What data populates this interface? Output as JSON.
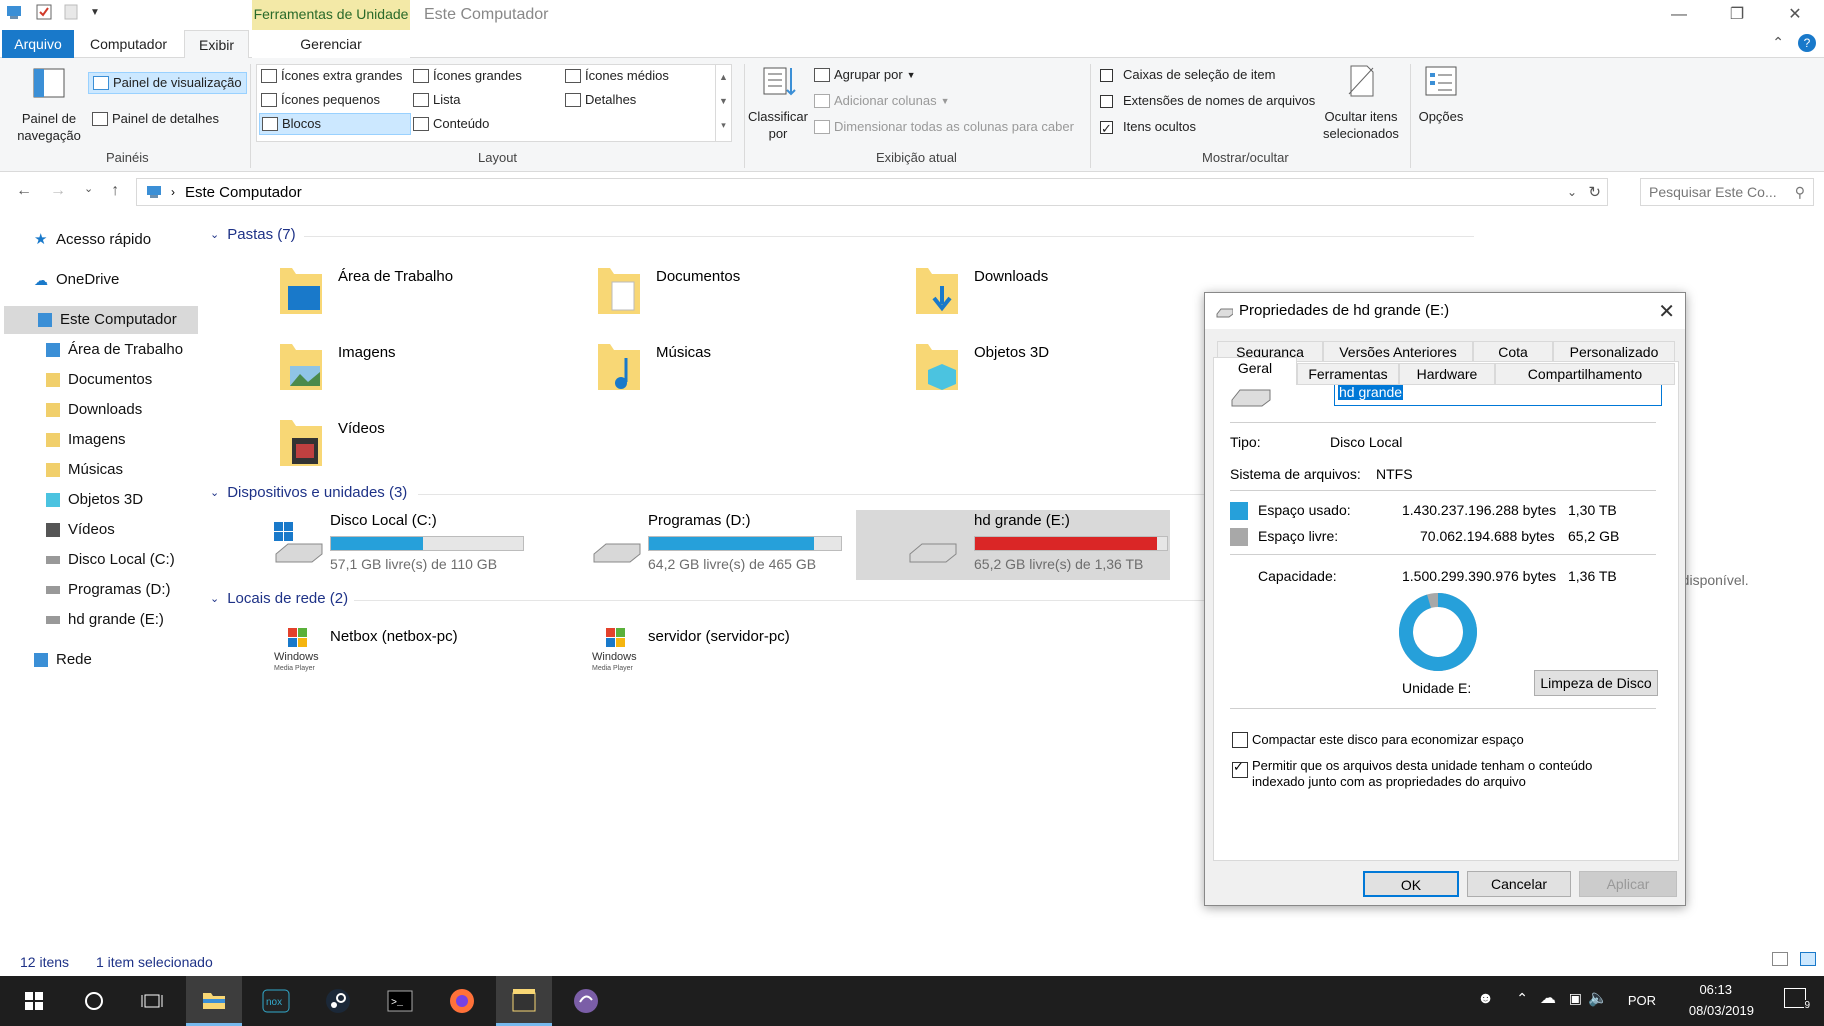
{
  "window": {
    "title": "Este Computador",
    "context_tab_group": "Ferramentas de Unidade"
  },
  "ribbon_tabs": [
    "Arquivo",
    "Computador",
    "Exibir",
    "Gerenciar"
  ],
  "ribbon": {
    "paineis": {
      "label": "Painéis",
      "nav_pane": "Painel de navegação",
      "preview_pane": "Painel de visualização",
      "details_pane": "Painel de detalhes"
    },
    "layout": {
      "label": "Layout",
      "items": [
        "Ícones extra grandes",
        "Ícones grandes",
        "Ícones médios",
        "Ícones pequenos",
        "Lista",
        "Detalhes",
        "Blocos",
        "Conteúdo"
      ]
    },
    "exibicao_atual": {
      "label": "Exibição atual",
      "sort_by": "Classificar por",
      "group_by": "Agrupar por",
      "add_columns": "Adicionar colunas",
      "size_columns": "Dimensionar todas as colunas para caber"
    },
    "mostrar_ocultar": {
      "label": "Mostrar/ocultar",
      "item_checkboxes": "Caixas de seleção de item",
      "extensions": "Extensões de nomes de arquivos",
      "hidden_items": "Itens ocultos",
      "hide_selected": "Ocultar itens selecionados",
      "options": "Opções"
    }
  },
  "address": {
    "path": "Este Computador",
    "search_placeholder": "Pesquisar Este Co..."
  },
  "nav_pane": {
    "items": [
      "Acesso rápido",
      "OneDrive",
      "Este Computador",
      "Área de Trabalho",
      "Documentos",
      "Downloads",
      "Imagens",
      "Músicas",
      "Objetos 3D",
      "Vídeos",
      "Disco Local (C:)",
      "Programas (D:)",
      "hd grande (E:)",
      "Rede"
    ]
  },
  "content": {
    "folders_header": "Pastas (7)",
    "folders": [
      "Área de Trabalho",
      "Documentos",
      "Downloads",
      "Imagens",
      "Músicas",
      "Objetos 3D",
      "Vídeos"
    ],
    "drives_header": "Dispositivos e unidades (3)",
    "drives": [
      {
        "name": "Disco Local (C:)",
        "free": "57,1 GB livre(s) de 110 GB",
        "used_fraction": 0.48,
        "color": "#26a0da"
      },
      {
        "name": "Programas (D:)",
        "free": "64,2 GB livre(s) de 465 GB",
        "used_fraction": 0.86,
        "color": "#26a0da"
      },
      {
        "name": "hd grande (E:)",
        "free": "65,2 GB livre(s) de 1,36 TB",
        "used_fraction": 0.95,
        "color": "#da2626"
      }
    ],
    "network_header": "Locais de rede (2)",
    "network": [
      "Netbox (netbox-pc)",
      "servidor (servidor-pc)"
    ],
    "preview_text": "o disponível."
  },
  "status": {
    "count": "12 itens",
    "selected": "1 item selecionado"
  },
  "dialog": {
    "title": "Propriedades de hd grande (E:)",
    "tabs_row1": [
      "Segurança",
      "Versões Anteriores",
      "Cota",
      "Personalizado"
    ],
    "tabs_row2": [
      "Geral",
      "Ferramentas",
      "Hardware",
      "Compartilhamento"
    ],
    "name_value": "hd grande",
    "type_label": "Tipo:",
    "type_value": "Disco Local",
    "fs_label": "Sistema de arquivos:",
    "fs_value": "NTFS",
    "used_label": "Espaço usado:",
    "used_bytes": "1.430.237.196.288 bytes",
    "used_size": "1,30 TB",
    "free_label": "Espaço livre:",
    "free_bytes": "70.062.194.688 bytes",
    "free_size": "65,2 GB",
    "capacity_label": "Capacidade:",
    "capacity_bytes": "1.500.299.390.976 bytes",
    "capacity_size": "1,36 TB",
    "drive_label": "Unidade E:",
    "cleanup": "Limpeza de Disco",
    "compress": "Compactar este disco para economizar espaço",
    "index_line1": "Permitir que os arquivos desta unidade tenham o conteúdo",
    "index_line2": "indexado junto com as propriedades do arquivo",
    "ok": "OK",
    "cancel": "Cancelar",
    "apply": "Aplicar",
    "used_color": "#26a0da",
    "free_color": "#a8a8a8",
    "used_fraction": 0.953
  },
  "tray": {
    "lang": "POR",
    "time": "06:13",
    "date": "08/03/2019",
    "notifications": "9"
  }
}
